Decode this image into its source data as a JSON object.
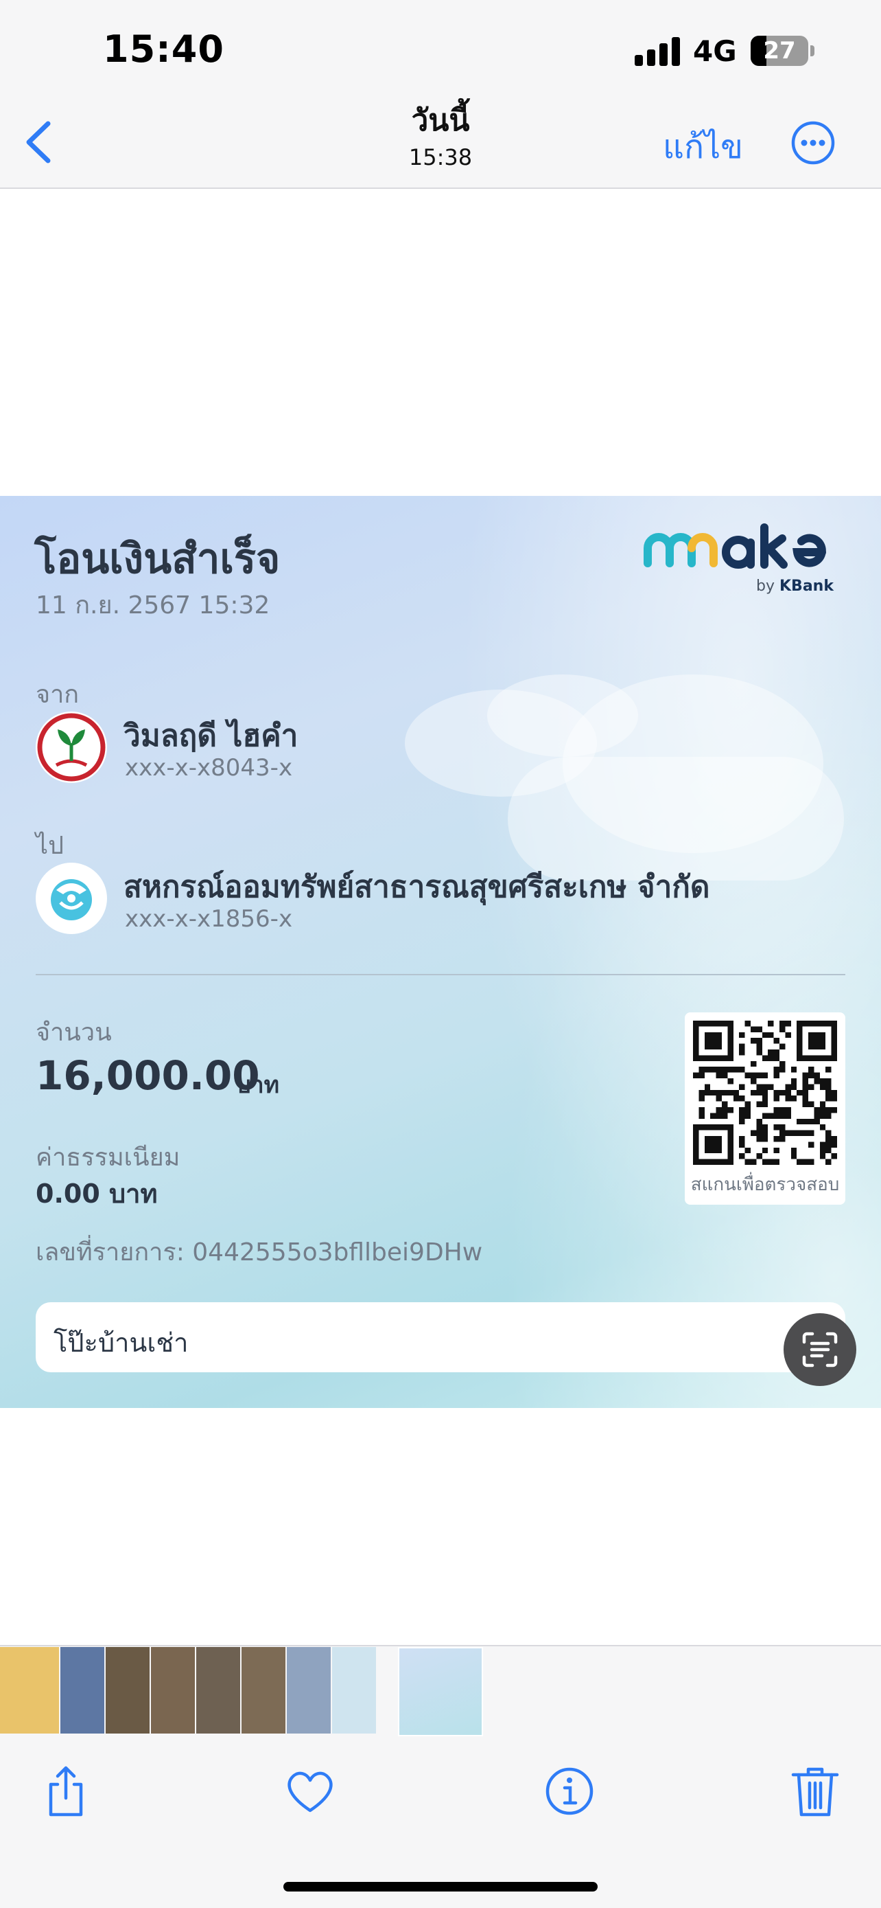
{
  "status_bar": {
    "time": "15:40",
    "network": "4G",
    "battery_level": "27",
    "battery_fraction": 0.27
  },
  "nav": {
    "back_icon": "chevron-left-icon",
    "title": "วันนี้",
    "subtitle": "15:38",
    "edit_label": "แก้ไข",
    "more_icon": "ellipsis-circle-icon",
    "accent_color": "#2f7cf6"
  },
  "receipt": {
    "title": "โอนเงินสำเร็จ",
    "datetime": "11 ก.ย. 2567 15:32",
    "brand_logo": "make by KBank",
    "from": {
      "label": "จาก",
      "name": "วิมลฤดี ไฮคำ",
      "account": "xxx-x-x8043-x",
      "icon": "kasikornbank-logo-icon"
    },
    "to": {
      "label": "ไป",
      "name": "สหกรณ์ออมทรัพย์สาธารณสุขศรีสะเกษ จำกัด",
      "account": "xxx-x-x1856-x",
      "icon": "krungthai-bank-logo-icon"
    },
    "amount_label": "จำนวน",
    "amount": "16,000.00",
    "amount_unit": "บาท",
    "fee_label": "ค่าธรรมเนียม",
    "fee": "0.00 บาท",
    "reference": "เลขที่รายการ: 0442555o3bfllbei9DHw",
    "qr_caption": "สแกนเพื่อตรวจสอบ",
    "memo": "โป๊ะบ้านเช่า"
  },
  "live_text_icon": "live-text-scan-icon",
  "filmstrip": {
    "thumbnails": [
      {
        "name": "document-photo",
        "color": "#e9c36a"
      },
      {
        "name": "eagle-photo",
        "color": "#5d77a3"
      },
      {
        "name": "coop-photo-1",
        "color": "#6a5a45"
      },
      {
        "name": "coop-photo-2",
        "color": "#7a6650"
      },
      {
        "name": "coop-photo-3",
        "color": "#6e6152"
      },
      {
        "name": "coop-photo-4",
        "color": "#7d6b55"
      },
      {
        "name": "blue-jar-photo",
        "color": "#8fa3bf"
      },
      {
        "name": "receipt-photo-1",
        "color": "#cfe4ef"
      },
      {
        "name": "receipt-photo-current",
        "color": "#d2e4f2"
      }
    ]
  },
  "toolbar": {
    "share_icon": "share-icon",
    "favorite_icon": "heart-icon",
    "info_icon": "info-icon",
    "delete_icon": "trash-icon"
  }
}
